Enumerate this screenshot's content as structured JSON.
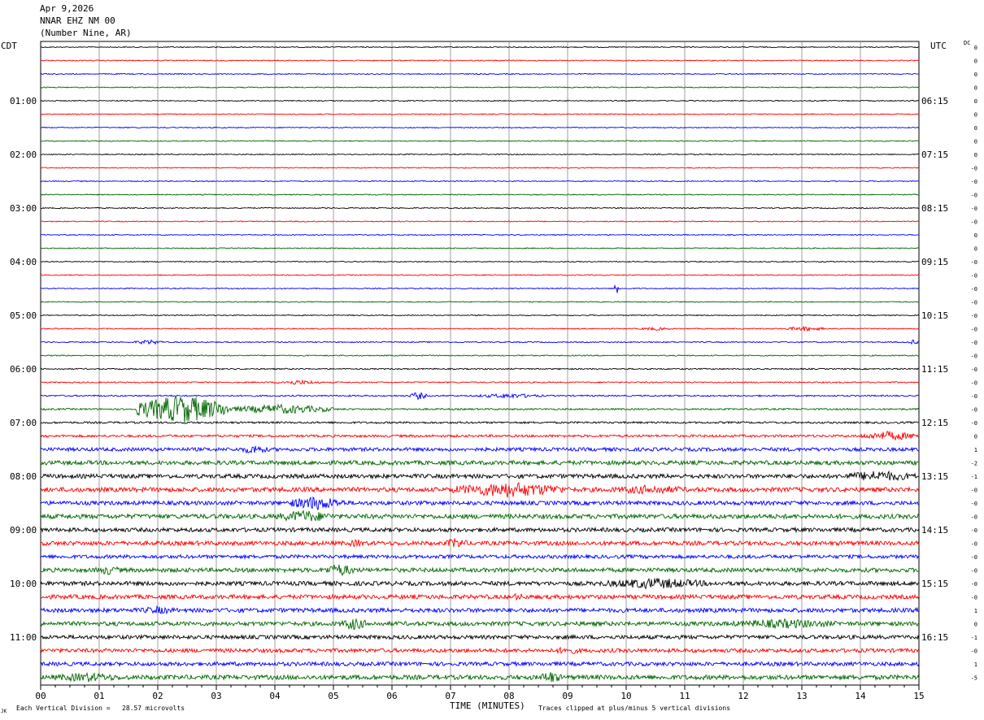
{
  "header": {
    "date": "Apr 9,2026",
    "station": "NNAR EHZ NM 00",
    "location": "(Number Nine, AR)"
  },
  "left_zone": "CDT",
  "right_zone": "UTC",
  "dc_label": "DC",
  "footer": {
    "scale_note": "Each Vertical Division =   28.57 microvolts",
    "clip_note": "Traces clipped at plus/minus 5 vertical divisions",
    "corner_mark": "JK"
  },
  "colors": {
    "trace_cycle": [
      "#000000",
      "#ff0000",
      "#0000ff",
      "#006600"
    ],
    "grid": "#888888"
  },
  "chart_data": {
    "type": "line",
    "title": "",
    "xlabel": "TIME (MINUTES)",
    "xlim": [
      0,
      15
    ],
    "x_ticks": [
      "00",
      "01",
      "02",
      "03",
      "04",
      "05",
      "06",
      "07",
      "08",
      "09",
      "10",
      "11",
      "12",
      "13",
      "14",
      "15"
    ],
    "rows": 48,
    "row_minutes": 15,
    "left_time_labels": [
      {
        "row": 4,
        "label": "01:00"
      },
      {
        "row": 8,
        "label": "02:00"
      },
      {
        "row": 12,
        "label": "03:00"
      },
      {
        "row": 16,
        "label": "04:00"
      },
      {
        "row": 20,
        "label": "05:00"
      },
      {
        "row": 24,
        "label": "06:00"
      },
      {
        "row": 28,
        "label": "07:00"
      },
      {
        "row": 32,
        "label": "08:00"
      },
      {
        "row": 36,
        "label": "09:00"
      },
      {
        "row": 40,
        "label": "10:00"
      },
      {
        "row": 44,
        "label": "11:00"
      }
    ],
    "right_time_labels": [
      {
        "row": 4,
        "label": "06:15"
      },
      {
        "row": 8,
        "label": "07:15"
      },
      {
        "row": 12,
        "label": "08:15"
      },
      {
        "row": 16,
        "label": "09:15"
      },
      {
        "row": 20,
        "label": "10:15"
      },
      {
        "row": 24,
        "label": "11:15"
      },
      {
        "row": 28,
        "label": "12:15"
      },
      {
        "row": 32,
        "label": "13:15"
      },
      {
        "row": 36,
        "label": "14:15"
      },
      {
        "row": 40,
        "label": "15:15"
      },
      {
        "row": 44,
        "label": "16:15"
      }
    ],
    "dc_offsets": [
      "0",
      "0",
      "0",
      "0",
      "0",
      "0",
      "0",
      "0",
      "0",
      "-0",
      "-0",
      "-0",
      "-0",
      "-0",
      "0",
      "0",
      "-0",
      "-0",
      "-0",
      "-0",
      "-0",
      "-0",
      "-0",
      "-0",
      "-0",
      "-0",
      "-0",
      "-0",
      "-0",
      "0",
      "1",
      "-2",
      "-1",
      "-0",
      "-0",
      "-0",
      "-0",
      "-0",
      "-0",
      "-0",
      "-0",
      "-0",
      "1",
      "0",
      "-1",
      "-0",
      "1",
      "-5"
    ],
    "noise_level": [
      0.6,
      0.6,
      0.6,
      0.6,
      0.6,
      0.6,
      0.6,
      0.6,
      0.6,
      0.6,
      0.6,
      0.6,
      0.6,
      0.6,
      0.6,
      0.6,
      0.6,
      0.6,
      0.6,
      0.6,
      0.6,
      0.6,
      0.7,
      0.7,
      0.8,
      0.8,
      0.9,
      1.0,
      1.2,
      1.5,
      2.2,
      2.6,
      2.6,
      2.8,
      2.5,
      2.8,
      2.5,
      2.6,
      2.2,
      2.6,
      2.6,
      2.6,
      2.6,
      2.6,
      2.4,
      2.4,
      2.4,
      2.8
    ],
    "events": [
      {
        "row": 18,
        "start_min": 9.8,
        "end_min": 9.9,
        "amp": 10
      },
      {
        "row": 21,
        "start_min": 10.2,
        "end_min": 10.8,
        "amp": 2
      },
      {
        "row": 21,
        "start_min": 12.7,
        "end_min": 13.4,
        "amp": 3
      },
      {
        "row": 22,
        "start_min": 1.6,
        "end_min": 2.1,
        "amp": 3
      },
      {
        "row": 22,
        "start_min": 14.8,
        "end_min": 15.0,
        "amp": 3
      },
      {
        "row": 25,
        "start_min": 4.0,
        "end_min": 4.8,
        "amp": 3
      },
      {
        "row": 26,
        "start_min": 6.3,
        "end_min": 6.6,
        "amp": 5
      },
      {
        "row": 26,
        "start_min": 7.4,
        "end_min": 8.6,
        "amp": 3
      },
      {
        "row": 27,
        "start_min": 1.6,
        "end_min": 3.2,
        "amp": 18
      },
      {
        "row": 27,
        "start_min": 3.2,
        "end_min": 5.0,
        "amp": 6
      },
      {
        "row": 29,
        "start_min": 14.0,
        "end_min": 15.0,
        "amp": 6
      },
      {
        "row": 30,
        "start_min": 3.4,
        "end_min": 3.9,
        "amp": 6
      },
      {
        "row": 32,
        "start_min": 13.6,
        "end_min": 15.0,
        "amp": 7
      },
      {
        "row": 33,
        "start_min": 7.0,
        "end_min": 9.0,
        "amp": 10
      },
      {
        "row": 33,
        "start_min": 9.6,
        "end_min": 11.2,
        "amp": 6
      },
      {
        "row": 34,
        "start_min": 4.2,
        "end_min": 5.2,
        "amp": 9
      },
      {
        "row": 35,
        "start_min": 4.0,
        "end_min": 5.0,
        "amp": 8
      },
      {
        "row": 37,
        "start_min": 5.2,
        "end_min": 5.6,
        "amp": 5
      },
      {
        "row": 37,
        "start_min": 6.9,
        "end_min": 7.3,
        "amp": 7
      },
      {
        "row": 39,
        "start_min": 0.9,
        "end_min": 1.4,
        "amp": 6
      },
      {
        "row": 39,
        "start_min": 4.8,
        "end_min": 5.4,
        "amp": 8
      },
      {
        "row": 40,
        "start_min": 9.5,
        "end_min": 11.5,
        "amp": 7
      },
      {
        "row": 41,
        "start_min": 8.0,
        "end_min": 8.3,
        "amp": 5
      },
      {
        "row": 42,
        "start_min": 1.6,
        "end_min": 2.4,
        "amp": 5
      },
      {
        "row": 43,
        "start_min": 5.1,
        "end_min": 5.6,
        "amp": 8
      },
      {
        "row": 43,
        "start_min": 11.6,
        "end_min": 13.8,
        "amp": 6
      },
      {
        "row": 45,
        "start_min": 8.7,
        "end_min": 9.3,
        "amp": 5
      },
      {
        "row": 47,
        "start_min": 0.1,
        "end_min": 1.5,
        "amp": 6
      },
      {
        "row": 47,
        "start_min": 8.5,
        "end_min": 8.9,
        "amp": 8
      }
    ]
  }
}
